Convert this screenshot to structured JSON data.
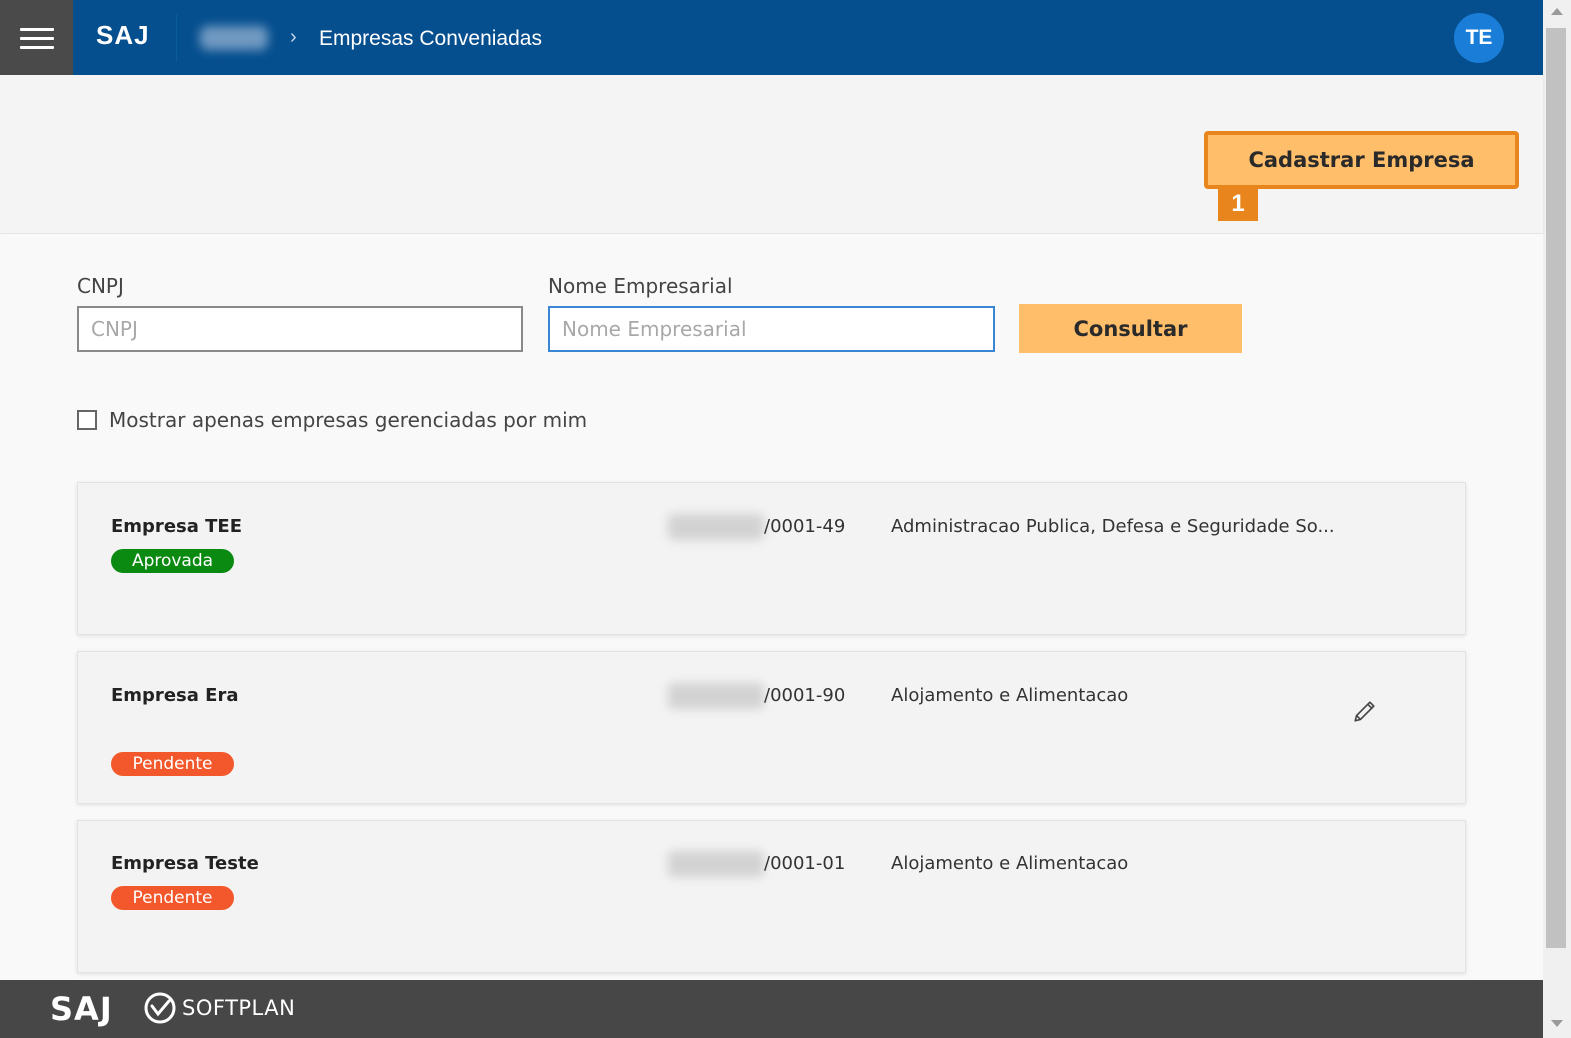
{
  "header": {
    "brand": "SAJ",
    "breadcrumb_chevron": "›",
    "page_title": "Empresas Conveniadas",
    "avatar_initials": "TE",
    "bar_color": "#064f8f"
  },
  "actions": {
    "cadastrar_label": "Cadastrar Empresa",
    "step_marker": "1"
  },
  "filters": {
    "cnpj_label": "CNPJ",
    "cnpj_placeholder": "CNPJ",
    "nome_label": "Nome Empresarial",
    "nome_placeholder": "Nome Empresarial",
    "consultar_label": "Consultar",
    "checkbox_label": "Mostrar apenas empresas gerenciadas por mim"
  },
  "companies": [
    {
      "name": "Empresa TEE",
      "status": "Aprovada",
      "cnpj_suffix": "/0001-49",
      "sector": "Administracao Publica, Defesa e Seguridade So..."
    },
    {
      "name": "Empresa Era",
      "status": "Pendente",
      "cnpj_suffix": "/0001-90",
      "sector": "Alojamento e Alimentacao"
    },
    {
      "name": "Empresa Teste",
      "status": "Pendente",
      "cnpj_suffix": "/0001-01",
      "sector": "Alojamento e Alimentacao"
    }
  ],
  "footer": {
    "saj": "SAJ",
    "softplan": "SOFTPLAN"
  },
  "icons": [
    "hamburger-menu-icon",
    "chevron-right-icon",
    "edit-pencil-icon",
    "softplan-logo-icon",
    "scroll-up-arrow-icon",
    "scroll-down-arrow-icon"
  ],
  "colors": {
    "accent": "#ffbe6a",
    "accent_border": "#e8851c",
    "approved": "#0b8a12",
    "pending": "#f2582b"
  }
}
